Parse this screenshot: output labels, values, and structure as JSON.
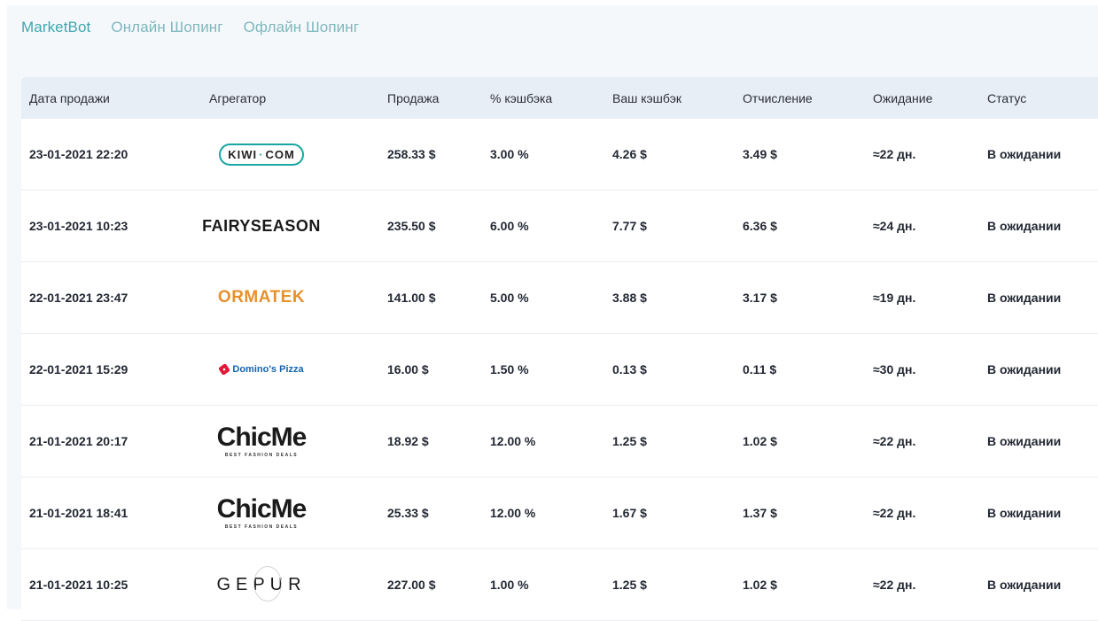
{
  "tabs": [
    {
      "label": "MarketBot",
      "active": true
    },
    {
      "label": "Онлайн Шопинг",
      "active": false
    },
    {
      "label": "Офлайн Шопинг",
      "active": false
    }
  ],
  "table": {
    "headers": [
      "Дата продажи",
      "Агрегатор",
      "Продажа",
      "% кэшбэка",
      "Ваш кэшбэк",
      "Отчисление",
      "Ожидание",
      "Статус"
    ],
    "rows": [
      {
        "date": "23-01-2021 22:20",
        "aggregator": "KIWI·COM",
        "logo_main": "KIWI",
        "logo_tail": "COM",
        "sale": "258.33 $",
        "percent": "3.00 %",
        "cashback": "4.26 $",
        "deduction": "3.49 $",
        "wait": "≈22 дн.",
        "status": "В ожидании"
      },
      {
        "date": "23-01-2021 10:23",
        "aggregator": "FAIRYSEASON",
        "sale": "235.50 $",
        "percent": "6.00 %",
        "cashback": "7.77 $",
        "deduction": "6.36 $",
        "wait": "≈24 дн.",
        "status": "В ожидании"
      },
      {
        "date": "22-01-2021 23:47",
        "aggregator": "ORMATEK",
        "sale": "141.00 $",
        "percent": "5.00 %",
        "cashback": "3.88 $",
        "deduction": "3.17 $",
        "wait": "≈19 дн.",
        "status": "В ожидании"
      },
      {
        "date": "22-01-2021 15:29",
        "aggregator": "Domino's Pizza",
        "sale": "16.00 $",
        "percent": "1.50 %",
        "cashback": "0.13 $",
        "deduction": "0.11 $",
        "wait": "≈30 дн.",
        "status": "В ожидании"
      },
      {
        "date": "21-01-2021 20:17",
        "aggregator": "ChicMe",
        "logo_sub": "BEST FASHION DEALS",
        "sale": "18.92 $",
        "percent": "12.00 %",
        "cashback": "1.25 $",
        "deduction": "1.02 $",
        "wait": "≈22 дн.",
        "status": "В ожидании"
      },
      {
        "date": "21-01-2021 18:41",
        "aggregator": "ChicMe",
        "logo_sub": "BEST FASHION DEALS",
        "sale": "25.33 $",
        "percent": "12.00 %",
        "cashback": "1.67 $",
        "deduction": "1.37 $",
        "wait": "≈22 дн.",
        "status": "В ожидании"
      },
      {
        "date": "21-01-2021 10:25",
        "aggregator": "GEPUR",
        "sale": "227.00 $",
        "percent": "1.00 %",
        "cashback": "1.25 $",
        "deduction": "1.02 $",
        "wait": "≈22 дн.",
        "status": "В ожидании"
      }
    ]
  },
  "colors": {
    "accent": "#3fa7ad",
    "tab_inactive": "#7fb7bd",
    "header_bg": "#e7eef5",
    "ormatek": "#e8902a",
    "kiwi": "#1aa6a1",
    "dominos": "#1565b0"
  }
}
